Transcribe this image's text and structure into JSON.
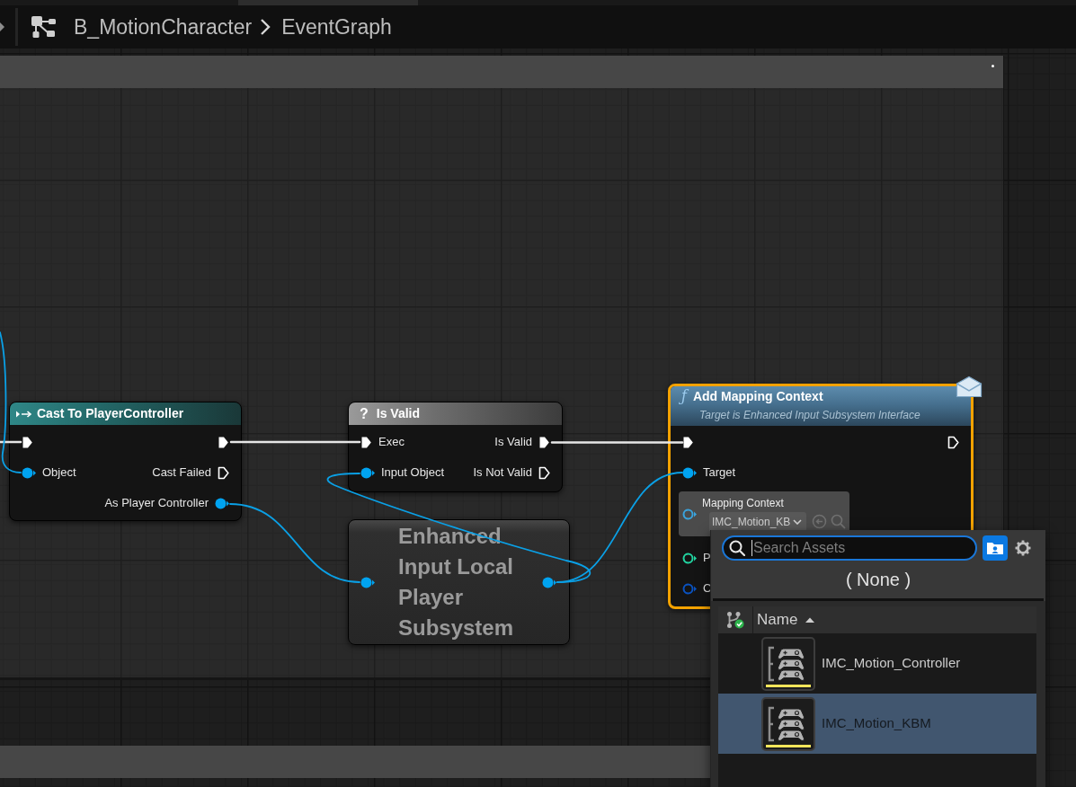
{
  "breadcrumb": [
    {
      "label": "B_MotionCharacter"
    },
    {
      "label": "EventGraph"
    }
  ],
  "graph": {
    "nodes": [
      {
        "kind": "cast",
        "title": "Cast To PlayerController",
        "selected": false,
        "inputs": [
          {
            "kind": "exec",
            "connected": true
          },
          {
            "kind": "data",
            "label": "Object",
            "color": "#00a3f0",
            "connected": true
          }
        ],
        "outputs": [
          {
            "kind": "exec",
            "connected": true
          },
          {
            "kind": "exec",
            "label": "Cast Failed",
            "connected": false
          },
          {
            "kind": "data",
            "label": "As Player Controller",
            "color": "#00a3f0",
            "connected": true
          }
        ]
      },
      {
        "kind": "macro",
        "glyph": "?",
        "title": "Is Valid",
        "selected": false,
        "inputs": [
          {
            "kind": "exec",
            "label": "Exec",
            "connected": true
          },
          {
            "kind": "data",
            "label": "Input Object",
            "color": "#00a3f0",
            "connected": true
          }
        ],
        "outputs": [
          {
            "kind": "exec",
            "label": "Is Valid",
            "connected": true
          },
          {
            "kind": "exec",
            "label": "Is Not Valid",
            "connected": false
          }
        ]
      },
      {
        "kind": "compact",
        "title": "Enhanced Input Local Player Subsystem",
        "selected": false,
        "inputs": [
          {
            "kind": "data",
            "color": "#00a3f0",
            "connected": true
          }
        ],
        "outputs": [
          {
            "kind": "data",
            "color": "#00a3f0",
            "connected": true
          }
        ]
      },
      {
        "kind": "function",
        "glyph": "ƒ",
        "title": "Add Mapping Context",
        "subtitle": "Target is Enhanced Input Subsystem Interface",
        "selected": true,
        "message": true,
        "inputs": [
          {
            "kind": "exec",
            "connected": true
          },
          {
            "kind": "data",
            "label": "Target",
            "color": "#00a3f0",
            "connected": true
          },
          {
            "kind": "data",
            "label": "Mapping Context",
            "color": "#3aa3dc",
            "connected": false,
            "value": "IMC_Motion_KB"
          },
          {
            "kind": "data",
            "label": "P",
            "color": "#22d3a0",
            "connected": false
          },
          {
            "kind": "data",
            "label": "C",
            "color": "#0a52c0",
            "connected": false
          }
        ],
        "outputs": [
          {
            "kind": "exec",
            "connected": false
          }
        ]
      }
    ]
  },
  "asset_picker": {
    "search": {
      "placeholder": "Search Assets",
      "focused": true
    },
    "none_option": "( None )",
    "columns": [
      {
        "label": "Name",
        "sorted_ascending": true
      }
    ],
    "assets": [
      {
        "name": "IMC_Motion_Controller",
        "selected": false
      },
      {
        "name": "IMC_Motion_KBM",
        "selected": true
      }
    ]
  }
}
